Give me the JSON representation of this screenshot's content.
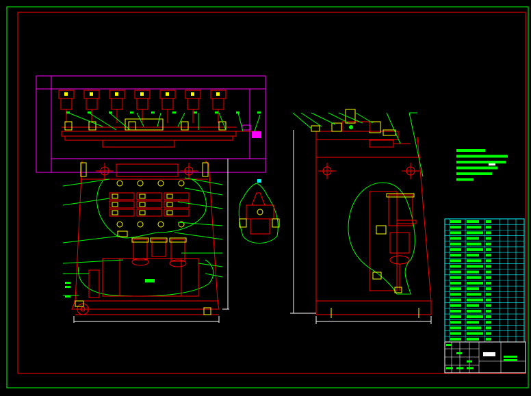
{
  "drawing": {
    "colors": {
      "background": "#000000",
      "outer_border": "#00ff00",
      "inner_border": "#ff0000",
      "red_lines": "#ff0000",
      "green_leaders": "#00ff00",
      "magenta_die": "#ff00ff",
      "white_dims": "#ffffff",
      "yellow_marks": "#ffff00",
      "cyan_table": "#00ffff"
    },
    "title_block": {
      "rows": 22,
      "columns": 7
    },
    "notes_block": {
      "lines": 6
    }
  }
}
